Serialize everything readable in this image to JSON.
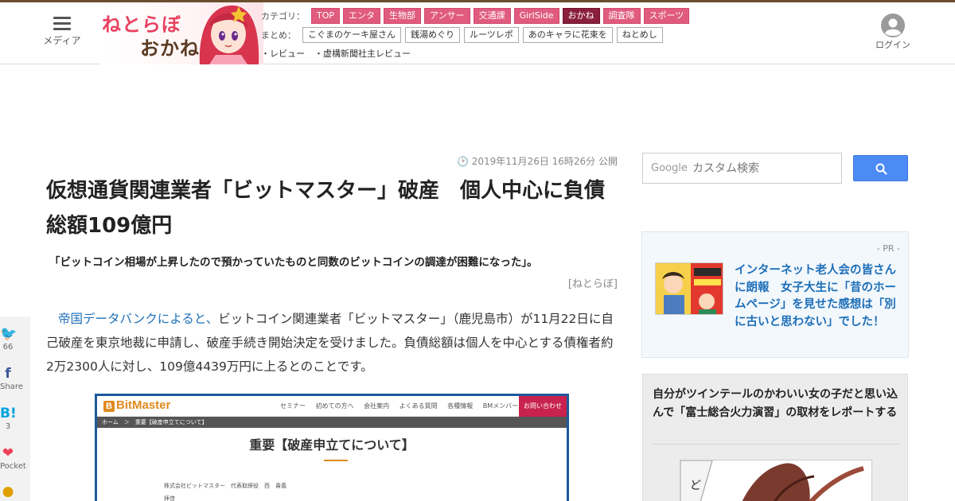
{
  "header": {
    "menu_label": "メディア",
    "logo_line1": "ねとらぼ",
    "logo_line2": "おかね",
    "category_label": "カテゴリ：",
    "categories": [
      "TOP",
      "エンタ",
      "生物部",
      "アンサー",
      "交通課",
      "GirlSide",
      "おかね",
      "調査隊",
      "スポーツ"
    ],
    "active_category": "おかね",
    "summary_label": "まとめ：",
    "summaries": [
      "こぐまのケーキ屋さん",
      "銭湯めぐり",
      "ルーツレポ",
      "あのキャラに花束を",
      "ねとめし"
    ],
    "sub_links": [
      "・レビュー",
      "・虚構新聞社主レビュー"
    ],
    "login_label": "ログイン"
  },
  "article": {
    "published": "2019年11月26日 16時26分 公開",
    "title": "仮想通貨関連業者「ビットマスター」破産　個人中心に負債総額109億円",
    "lead": "「ビットコイン相場が上昇したので預かっていたものと同数のビットコインの調達が困難になった」。",
    "source": "[ねとらぼ]",
    "body_link": "帝国データバンクによると、",
    "body_rest": "ビットコイン関連業者「ビットマスター」（鹿児島市）が11月22日に自己破産を東京地裁に申請し、破産手続き開始決定を受けました。負債総額は個人を中心とする債権者約2万2300人に対し、109億4439万円に上るとのことです。",
    "image": {
      "logo": "BitMaster",
      "nav": [
        "セミナー",
        "初めての方へ",
        "会社案内",
        "よくある質問",
        "各種情報",
        "BMメンバーズラウンジ"
      ],
      "contact": "お問い合わせ",
      "breadcrumb": "ホーム　＞　重要【破産申立てについて】",
      "heading": "重要【破産申立てについて】",
      "line1": "株式会社ビットマスター　代表取締役　西　貴義",
      "line2": "拝啓"
    }
  },
  "social": [
    {
      "icon": "twitter-icon",
      "glyph": "🐦",
      "count": "66",
      "color": "#1da1f2"
    },
    {
      "icon": "facebook-icon",
      "glyph": "f",
      "count": "Share",
      "color": "#3b5998"
    },
    {
      "icon": "hatena-icon",
      "glyph": "B!",
      "count": "3",
      "color": "#00a4de"
    },
    {
      "icon": "pocket-icon",
      "glyph": "❤",
      "count": "Pocket",
      "color": "#ef4056"
    },
    {
      "icon": "line-icon",
      "glyph": "●",
      "count": "",
      "color": "#e0a000"
    }
  ],
  "sidebar": {
    "search_placeholder": "カスタム検索",
    "search_brand": "Google",
    "pr_label": "- PR -",
    "pr_text": "インターネット老人会の皆さんに朗報　女子大生に「昔のホームページ」を見せた感想は「別に古いと思わない」でした！",
    "related_title": "自分がツインテールのかわいい女の子だと思い込んで「富士総合火力演習」の取材をレポートする"
  },
  "colors": {
    "category_bg": "#e05b7e",
    "category_active": "#8a1e3c",
    "link": "#1d6fb8",
    "search_button": "#4c8bf5",
    "header_border": "#6b4e2e"
  }
}
